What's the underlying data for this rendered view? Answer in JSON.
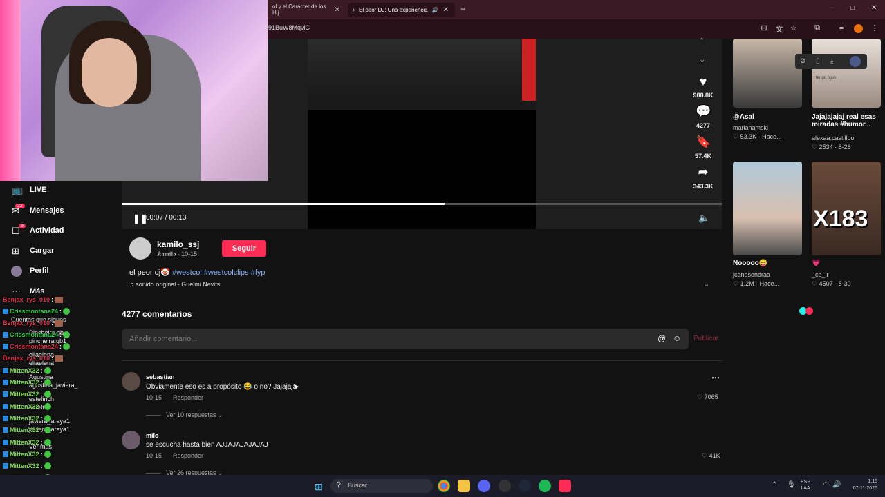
{
  "browser": {
    "tabs": [
      {
        "label": "ol y el Carácter de los Hij"
      },
      {
        "label": "El peor DJ: Una experiencia"
      }
    ],
    "url": "91BuW8MqvlC",
    "window_controls": [
      "–",
      "□",
      "✕"
    ]
  },
  "video": {
    "progress": 0.538,
    "time": "00:07 / 00:13",
    "actions": [
      {
        "icon": "heart-icon",
        "count": "988.8K"
      },
      {
        "icon": "comment-icon",
        "count": "4277"
      },
      {
        "icon": "bookmark-icon",
        "count": "57.4K"
      },
      {
        "icon": "share-icon",
        "count": "343.3K"
      }
    ]
  },
  "creator": {
    "username": "kamilo_ssj",
    "display": "𝕶𝖆𝖒𝖎𝖑𝖔 · 10-15",
    "follow_label": "Seguir",
    "caption_text": "el peor dj🤡",
    "hashtags": "#westcol #westcolclips #fyp",
    "sound": "♫ sonido original - Guelmi Nevits"
  },
  "comments": {
    "title": "4277 comentarios",
    "input_placeholder": "Añadir comentario...",
    "publish_label": "Publicar",
    "items": [
      {
        "name": "sebastian",
        "text": "Obviamente eso es a propósito 😂 o no? Jajajaja",
        "date": "10-15",
        "reply": "Responder",
        "likes": "7065",
        "more": "Ver 10 respuestas ⌄"
      },
      {
        "name": "milo",
        "text": "se escucha hasta bien AJJAJAJAJAJAJ",
        "date": "10-15",
        "reply": "Responder",
        "likes": "41K",
        "more": "Ver 26 respuestas ⌄"
      }
    ]
  },
  "recommended": [
    {
      "title": "@Asal",
      "user": "marianamski",
      "stats": "♡ 53.3K · Hace..."
    },
    {
      "title": "Jajajajajaj real esas miradas #humor...",
      "user": "alexaa.castilloo",
      "stats": "♡ 2534 · 8-28"
    },
    {
      "title": "Nooooo😝",
      "user": "jcandsondraa",
      "stats": "♡ 1.2M · Hace..."
    },
    {
      "title": "💗",
      "user": "_cb_ir",
      "stats": "♡ 4507 · 8-30"
    }
  ],
  "rec_overlay_texts": [
    "tengo hijos",
    "X183"
  ],
  "sidebar": {
    "items": [
      {
        "label": "LIVE",
        "icon": "live-icon"
      },
      {
        "label": "Mensajes",
        "icon": "messages-icon",
        "badge": "22"
      },
      {
        "label": "Actividad",
        "icon": "activity-icon",
        "badge": "8"
      },
      {
        "label": "Cargar",
        "icon": "upload-icon"
      },
      {
        "label": "Perfil",
        "icon": "profile-icon"
      },
      {
        "label": "Más",
        "icon": "more-icon"
      }
    ],
    "following_title": "Cuentas que sigues",
    "following": [
      "Pincheira.gb",
      "pincheira.gb1",
      "eliaelena",
      "eliaelena",
      "Agustina",
      "agustina_javiera_",
      "estefinch",
      "estefi",
      "javiera_araya1",
      "javiera_araya1",
      "Ver más"
    ]
  },
  "chat": [
    {
      "user": "Benjax_rys_010",
      "color": "#e0304a"
    },
    {
      "user": "Crissmontana24",
      "color": "#2ed04a"
    },
    {
      "user": "Benjax_rys_010",
      "color": "#e0304a"
    },
    {
      "user": "Crissmontana24",
      "color": "#2ed04a"
    },
    {
      "user": "Crissmontana24",
      "color": "#e0304a"
    },
    {
      "user": "Benjax_rys_010",
      "color": "#e0304a"
    },
    {
      "user": "MittenX32",
      "color": "#7be04a"
    },
    {
      "user": "MittenX32",
      "color": "#7be04a"
    },
    {
      "user": "MittenX32",
      "color": "#7be04a"
    },
    {
      "user": "MittenX32",
      "color": "#7be04a"
    },
    {
      "user": "MittenX32",
      "color": "#7be04a"
    },
    {
      "user": "MittenX32",
      "color": "#7be04a"
    },
    {
      "user": "MittenX32",
      "color": "#7be04a"
    },
    {
      "user": "MittenX32",
      "color": "#7be04a"
    },
    {
      "user": "MittenX32",
      "color": "#7be04a"
    },
    {
      "user": "MittenX32",
      "color": "#7be04a"
    }
  ],
  "taskbar": {
    "search_placeholder": "Buscar",
    "lang": "ESP",
    "region": "LAA",
    "time": "1:15",
    "date": "07-11-2025"
  },
  "colors": {
    "accent": "#fe2c55",
    "link": "#8ab4f8"
  }
}
